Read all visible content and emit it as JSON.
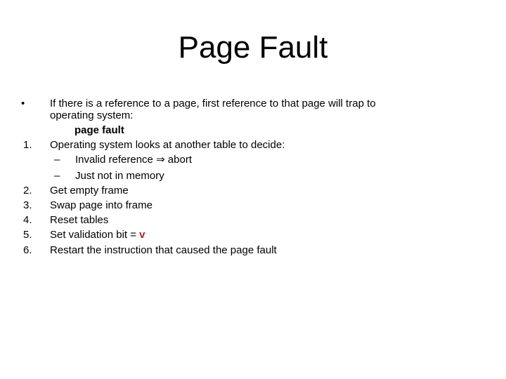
{
  "slide": {
    "title": "Page Fault",
    "intro": {
      "bullet": "•",
      "line1": "If there is a reference to a page, first reference to that page will trap to",
      "line2": "operating system:",
      "emphasis": "page fault"
    },
    "steps": [
      {
        "num": "1.",
        "text": "Operating system looks at another table to decide:"
      },
      {
        "num": "2.",
        "text": "Get empty frame"
      },
      {
        "num": "3.",
        "text": "Swap page into frame"
      },
      {
        "num": "4.",
        "text": "Reset tables"
      },
      {
        "num": "5.",
        "text": "Set validation bit = ",
        "highlight": "v"
      },
      {
        "num": "6.",
        "text": "Restart the instruction that caused the page fault"
      }
    ],
    "subitems": [
      {
        "dash": "–",
        "text": "Invalid reference ⇒ abort"
      },
      {
        "dash": "–",
        "text": "Just not in memory"
      }
    ],
    "highlight_color": "#B22222"
  }
}
